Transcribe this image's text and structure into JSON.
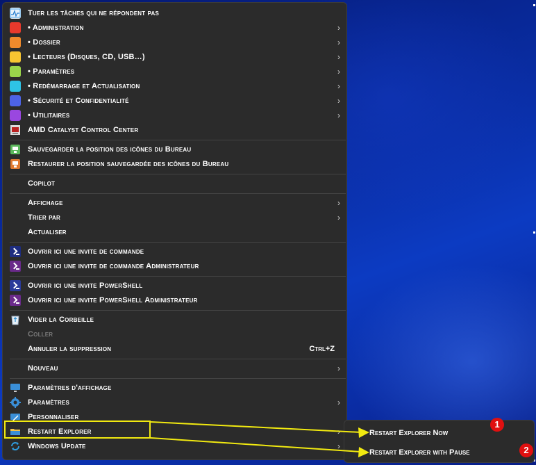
{
  "menu": {
    "items": [
      {
        "label": "Tuer les tâches qui ne répondent pas",
        "icon": "taskmgr-icon",
        "color": "#4aa3e8",
        "arrow": false
      },
      {
        "label": "• Administration",
        "icon": "red-square-icon",
        "color": "#e8392c",
        "arrow": true
      },
      {
        "label": "• Dossier",
        "icon": "orange-square-icon",
        "color": "#f08a2c",
        "arrow": true
      },
      {
        "label": "• Lecteurs (Disques, CD, USB…)",
        "icon": "yellow-square-icon",
        "color": "#f7c531",
        "arrow": true
      },
      {
        "label": "• Paramètres",
        "icon": "lime-square-icon",
        "color": "#9ad54a",
        "arrow": true
      },
      {
        "label": "• Redémarrage et Actualisation",
        "icon": "cyan-square-icon",
        "color": "#2ec3e6",
        "arrow": true
      },
      {
        "label": "• Sécurité et Confidentialité",
        "icon": "blue-square-icon",
        "color": "#4d63e6",
        "arrow": true
      },
      {
        "label": "• Utilitaires",
        "icon": "purple-square-icon",
        "color": "#9a47e0",
        "arrow": true
      },
      {
        "label": "AMD Catalyst Control Center",
        "icon": "amd-icon",
        "color": "#d9d9d9",
        "arrow": false
      },
      {
        "label": "Sauvegarder la position des icônes du Bureau",
        "icon": "save-desktop-icon",
        "color": "#5cb85c",
        "arrow": false
      },
      {
        "label": "Restaurer la position sauvegardée des icônes du Bureau",
        "icon": "restore-desktop-icon",
        "color": "#e07a30",
        "arrow": false
      },
      {
        "label": "Copilot",
        "icon": "",
        "color": "",
        "arrow": false
      },
      {
        "label": "Affichage",
        "icon": "",
        "color": "",
        "arrow": true
      },
      {
        "label": "Trier par",
        "icon": "",
        "color": "",
        "arrow": true
      },
      {
        "label": "Actualiser",
        "icon": "",
        "color": "",
        "arrow": false
      },
      {
        "label": "Ouvrir ici une invite de commande",
        "icon": "cmd-icon",
        "color": "#1e2d80",
        "arrow": false
      },
      {
        "label": "Ouvrir ici une invite de commande Administrateur",
        "icon": "cmd-admin-icon",
        "color": "#6a2a8a",
        "arrow": false
      },
      {
        "label": "Ouvrir ici une invite PowerShell",
        "icon": "powershell-icon",
        "color": "#2a3a9a",
        "arrow": false
      },
      {
        "label": "Ouvrir ici une invite PowerShell Administrateur",
        "icon": "powershell-admin-icon",
        "color": "#6a2a8a",
        "arrow": false
      },
      {
        "label": "Vider la Corbeille",
        "icon": "recycle-bin-icon",
        "color": "#d9e8f5",
        "arrow": false
      },
      {
        "label": "Coller",
        "icon": "",
        "color": "",
        "arrow": false,
        "disabled": true
      },
      {
        "label": "Annuler la suppression",
        "icon": "",
        "color": "",
        "arrow": false,
        "shortcut": "Ctrl+Z"
      },
      {
        "label": "Nouveau",
        "icon": "",
        "color": "",
        "arrow": true
      },
      {
        "label": "Paramètres d'affichage",
        "icon": "display-settings-icon",
        "color": "#3a8fd8",
        "arrow": false
      },
      {
        "label": "Paramètres",
        "icon": "gear-icon",
        "color": "#3a8fd8",
        "arrow": true
      },
      {
        "label": "Personnaliser",
        "icon": "personalize-icon",
        "color": "#3a8fd8",
        "arrow": false
      },
      {
        "label": "Restart Explorer",
        "icon": "folder-icon",
        "color": "#f2c24a",
        "arrow": true
      },
      {
        "label": "Windows Update",
        "icon": "windows-update-icon",
        "color": "#2f9de0",
        "arrow": true
      }
    ]
  },
  "submenu": {
    "items": [
      {
        "label": "Restart Explorer Now",
        "badge": "1"
      },
      {
        "label": "Restart Explorer with Pause",
        "badge": "2"
      }
    ]
  },
  "annotation_color": "#f2ea10",
  "badge_color": "#e01010"
}
